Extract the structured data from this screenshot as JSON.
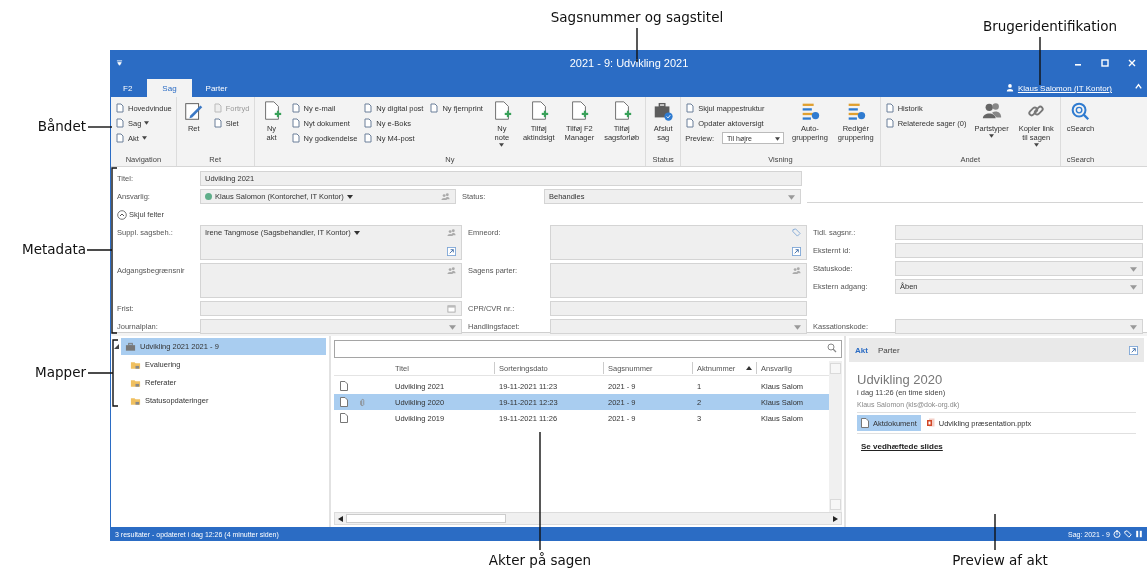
{
  "callouts": [
    {
      "text": "Sagsnummer og sagstitel"
    },
    {
      "text": "Brugeridentifikation"
    },
    {
      "text": "Båndet"
    },
    {
      "text": "Metadata"
    },
    {
      "text": "Mapper"
    },
    {
      "text": "Akter på sagen"
    },
    {
      "text": "Preview af akt"
    }
  ],
  "window": {
    "title": "2021 - 9: Udvikling 2021"
  },
  "tabs": [
    {
      "label": "F2",
      "selected": false
    },
    {
      "label": "Sag",
      "selected": true
    },
    {
      "label": "Parter",
      "selected": false
    }
  ],
  "user": "Klaus Salomon (IT Kontor)",
  "ribbon": {
    "groups": [
      {
        "label": "Navigation",
        "items": [
          {
            "kind": "stack",
            "items": [
              {
                "kind": "small",
                "label": "Hovedvindue",
                "dropdown": false,
                "disabled": false
              },
              {
                "kind": "small",
                "label": "Sag",
                "dropdown": true,
                "disabled": false
              },
              {
                "kind": "small",
                "label": "Akt",
                "dropdown": true,
                "disabled": false
              }
            ]
          }
        ]
      },
      {
        "label": "Ret",
        "items": [
          {
            "kind": "large",
            "lines": [
              "Ret"
            ],
            "dropdown": false
          },
          {
            "kind": "stack",
            "items": [
              {
                "kind": "small",
                "label": "Fortryd",
                "dropdown": false,
                "disabled": true
              },
              {
                "kind": "small",
                "label": "Slet",
                "dropdown": false,
                "disabled": false
              }
            ]
          }
        ]
      },
      {
        "label": "Ny",
        "items": [
          {
            "kind": "large",
            "lines": [
              "Ny",
              "akt"
            ],
            "dropdown": false
          },
          {
            "kind": "stack",
            "items": [
              {
                "kind": "small",
                "label": "Ny e-mail",
                "dropdown": false,
                "disabled": false
              },
              {
                "kind": "small",
                "label": "Nyt dokument",
                "dropdown": false,
                "disabled": false
              },
              {
                "kind": "small",
                "label": "Ny godkendelse",
                "dropdown": false,
                "disabled": false
              }
            ]
          },
          {
            "kind": "stack",
            "items": [
              {
                "kind": "small",
                "label": "Ny digital post",
                "dropdown": false,
                "disabled": false
              },
              {
                "kind": "small",
                "label": "Ny e-Boks",
                "dropdown": false,
                "disabled": false
              },
              {
                "kind": "small",
                "label": "Ny M4-post",
                "dropdown": false,
                "disabled": false
              }
            ]
          },
          {
            "kind": "stack",
            "items": [
              {
                "kind": "small",
                "label": "Ny fjernprint",
                "dropdown": false,
                "disabled": false
              }
            ]
          },
          {
            "kind": "large",
            "lines": [
              "Ny",
              "note"
            ],
            "dropdown": true
          },
          {
            "kind": "large",
            "lines": [
              "Tilføj",
              "aktindsigt"
            ],
            "dropdown": false
          },
          {
            "kind": "large",
            "lines": [
              "Tilføj F2",
              "Manager"
            ],
            "dropdown": false
          },
          {
            "kind": "large",
            "lines": [
              "Tilføj",
              "sagsforløb"
            ],
            "dropdown": false
          }
        ]
      },
      {
        "label": "Status",
        "items": [
          {
            "kind": "large",
            "lines": [
              "Afslut",
              "sag"
            ],
            "dropdown": false
          }
        ]
      },
      {
        "label": "Visning",
        "items": [
          {
            "kind": "stack",
            "items": [
              {
                "kind": "small",
                "label": "Skjul mappestruktur",
                "dropdown": false,
                "disabled": false
              },
              {
                "kind": "small",
                "label": "Opdater aktoversigt",
                "dropdown": false,
                "disabled": false
              },
              {
                "kind": "combo",
                "label": "Preview:",
                "value": "Til højre"
              }
            ]
          },
          {
            "kind": "large",
            "lines": [
              "Auto-",
              "gruppering"
            ],
            "dropdown": false
          },
          {
            "kind": "large",
            "lines": [
              "Redigér",
              "gruppering"
            ],
            "dropdown": false
          }
        ]
      },
      {
        "label": "Andet",
        "items": [
          {
            "kind": "stack",
            "items": [
              {
                "kind": "small",
                "label": "Historik",
                "dropdown": false,
                "disabled": false
              },
              {
                "kind": "small",
                "label": "Relaterede sager (0)",
                "dropdown": false,
                "disabled": false
              }
            ]
          },
          {
            "kind": "large",
            "lines": [
              "Partstyper"
            ],
            "dropdown": true
          },
          {
            "kind": "large",
            "lines": [
              "Kopier link",
              "til sagen"
            ],
            "dropdown": true
          }
        ]
      },
      {
        "label": "cSearch",
        "items": [
          {
            "kind": "large",
            "lines": [
              "cSearch"
            ],
            "dropdown": false
          }
        ]
      }
    ]
  },
  "metadata": {
    "title": {
      "label": "Titel:",
      "value": "Udvikling 2021"
    },
    "owner": {
      "label": "Ansvarlig:",
      "value": "Klaus Salomon (Kontorchef, IT Kontor)",
      "color": "#5fae8a"
    },
    "status": {
      "label": "Status:",
      "value": "Behandles"
    },
    "toggle": "Skjul felter",
    "columns": [
      [
        {
          "label": "Suppl. sagsbeh.:",
          "value": "Irene Tangmose (Sagsbehandler, IT Kontor)",
          "kind": "persons",
          "expand": true
        },
        {
          "label": "Adgangsbegrænsnir",
          "kind": "persons",
          "expand": false
        },
        {
          "label": "Frist:",
          "kind": "date"
        },
        {
          "label": "Journalplan:",
          "kind": "combo"
        }
      ],
      [
        {
          "label": "Emneord:",
          "kind": "keywords",
          "expand": true
        },
        {
          "label": "Sagens parter:",
          "kind": "persons",
          "expand": false
        },
        {
          "label": "CPR/CVR nr.:",
          "kind": "text"
        },
        {
          "label": "Handlingsfacet:",
          "kind": "combo"
        }
      ],
      [
        {
          "label": "Tidl. sagsnr.:",
          "kind": "text"
        },
        {
          "label": "Eksternt id:",
          "kind": "text"
        },
        {
          "label": "Statuskode:",
          "kind": "combo"
        },
        {
          "label": "Ekstern adgang:",
          "kind": "combo",
          "value": "Åben"
        },
        {
          "label": "Kassationskode:",
          "kind": "combo"
        }
      ]
    ]
  },
  "folders": [
    {
      "label": "Udvikling 2021 2021 - 9",
      "selected": true,
      "expanded": true,
      "children": [
        {
          "label": "Evaluering",
          "selected": false
        },
        {
          "label": "Referater",
          "selected": false
        },
        {
          "label": "Statusopdateringer",
          "selected": false
        }
      ]
    }
  ],
  "table": {
    "columns": [
      {
        "label": "Titel",
        "sorted": false
      },
      {
        "label": "Sorteringsdato",
        "sorted": false
      },
      {
        "label": "Sagsnummer",
        "sorted": false
      },
      {
        "label": "Aktnummer",
        "sorted": true
      },
      {
        "label": "Ansvarlig",
        "sorted": false
      }
    ],
    "rows": [
      {
        "cells": [
          "Udvikling 2021",
          "19-11-2021 11:23",
          "2021 - 9",
          "1",
          "Klaus Salom"
        ],
        "attachment": false,
        "selected": false
      },
      {
        "cells": [
          "Udvikling 2020",
          "19-11-2021 12:23",
          "2021 - 9",
          "2",
          "Klaus Salom"
        ],
        "attachment": true,
        "selected": true
      },
      {
        "cells": [
          "Udvikling 2019",
          "19-11-2021 11:26",
          "2021 - 9",
          "3",
          "Klaus Salom"
        ],
        "attachment": false,
        "selected": false
      }
    ]
  },
  "preview": {
    "tabs": [
      {
        "label": "Akt",
        "selected": true
      },
      {
        "label": "Parter",
        "selected": false
      }
    ],
    "title": "Udvikling 2020",
    "time": "i dag 11:26 (en time siden)",
    "author": "Klaus Salomon (kls@dok-org.dk)",
    "files": [
      {
        "label": "Aktdokument",
        "kind": "document",
        "selected": true
      },
      {
        "label": "Udvikling præsentation.pptx",
        "kind": "presentation",
        "selected": false
      }
    ],
    "link": "Se vedhæftede slides"
  },
  "status_bar": {
    "left": "3 resultater - opdateret i dag 12:26 (4 minutter siden)",
    "right": "Sag: 2021 - 9"
  }
}
